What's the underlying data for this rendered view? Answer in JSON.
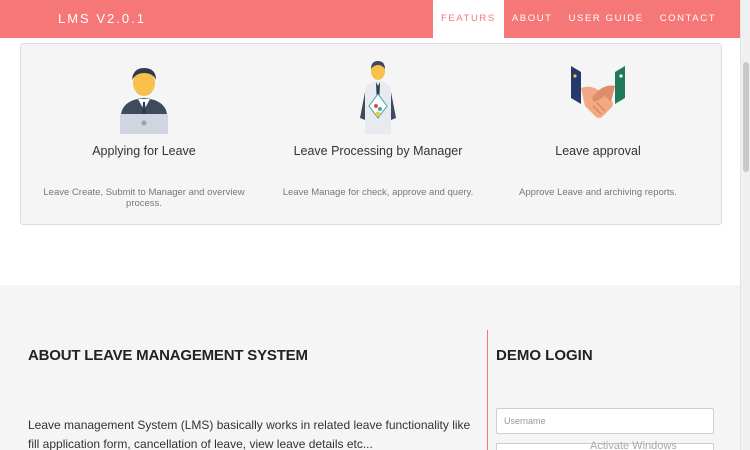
{
  "brand": "LMS V2.0.1",
  "nav": {
    "items": [
      {
        "label": "FEATURS",
        "active": true
      },
      {
        "label": "ABOUT",
        "active": false
      },
      {
        "label": "USER GUIDE",
        "active": false
      },
      {
        "label": "CONTACT",
        "active": false
      }
    ]
  },
  "features": [
    {
      "icon": "businessman-laptop-icon",
      "title": "Applying for Leave",
      "desc": "Leave Create, Submit to Manager and overview process."
    },
    {
      "icon": "manager-icon",
      "title": "Leave Processing by Manager",
      "desc": "Leave Manage for check, approve and query."
    },
    {
      "icon": "handshake-icon",
      "title": "Leave approval",
      "desc": "Approve Leave and archiving reports."
    }
  ],
  "about": {
    "title": "ABOUT LEAVE MANAGEMENT SYSTEM",
    "text": "Leave management System (LMS) basically works in related leave functionality like fill application form, cancellation of leave, view leave details etc..."
  },
  "demo": {
    "title": "DEMO LOGIN",
    "username_placeholder": "Username"
  },
  "watermark": "Activate Windows",
  "colors": {
    "accent": "#f57777",
    "panel": "#f5f5f5"
  }
}
